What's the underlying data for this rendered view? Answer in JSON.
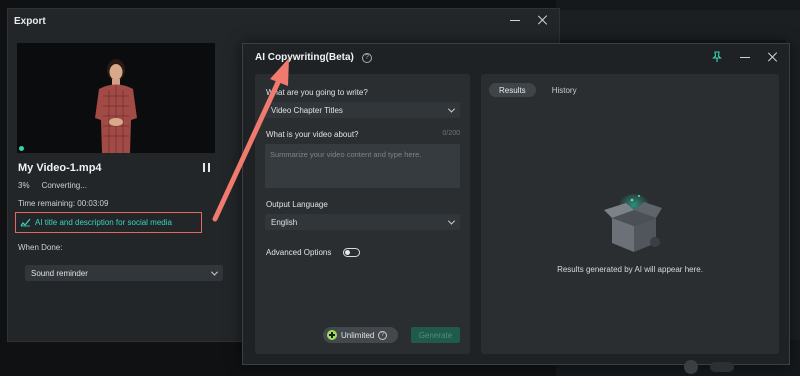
{
  "export_window": {
    "title": "Export",
    "filename": "My Video-1.mp4",
    "progress_percent": "3%",
    "status": "Converting...",
    "time_remaining": "Time remaining: 00:03:09",
    "ai_link": "AI title and description for social media",
    "when_done_label": "When Done:",
    "when_done_value": "Sound reminder"
  },
  "ai_window": {
    "title": "AI Copywriting(Beta)",
    "write_label": "What are you going to write?",
    "write_value": "Video Chapter Titles",
    "about_label": "What is your video about?",
    "about_counter": "0/200",
    "about_placeholder": "Summarize your video content and type here.",
    "language_label": "Output Language",
    "language_value": "English",
    "advanced_label": "Advanced Options",
    "unlimited_label": "Unlimited",
    "generate_label": "Generate",
    "tabs": [
      "Results",
      "History"
    ],
    "empty_message": "Results generated by AI will appear here."
  },
  "colors": {
    "accent": "#3ad6b3",
    "highlight_border": "#e5675f",
    "annotation_arrow": "#f07a6e"
  }
}
